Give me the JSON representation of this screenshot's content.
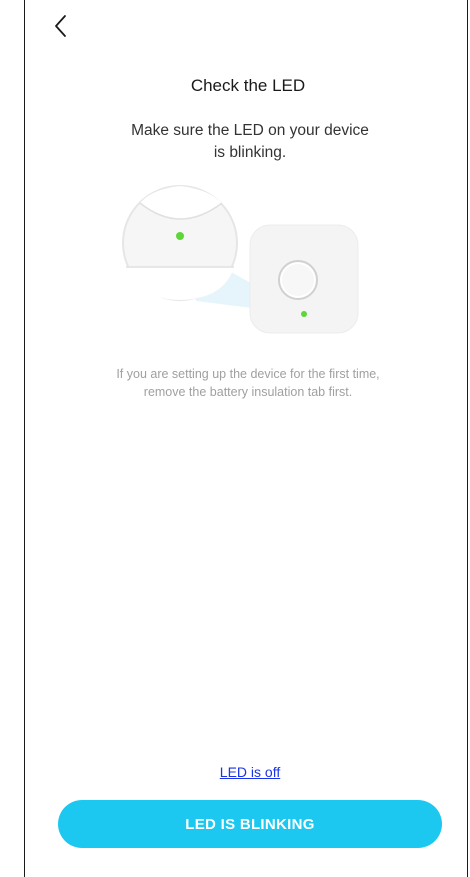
{
  "header": {
    "back_icon": "chevron-left-icon"
  },
  "content": {
    "title": "Check the LED",
    "subtitle_line1": "Make sure the LED on your device",
    "subtitle_line2": "is blinking.",
    "note_line1": "If you are setting up the device for the first time,",
    "note_line2": "remove the battery insulation tab first."
  },
  "actions": {
    "led_off_link": "LED is off",
    "led_blinking_button": "LED IS BLINKING"
  },
  "colors": {
    "accent": "#1cc8f0",
    "led": "#5ed63a",
    "link": "#1a33e6"
  },
  "illustration": {
    "icon": "device-led-illustration"
  }
}
